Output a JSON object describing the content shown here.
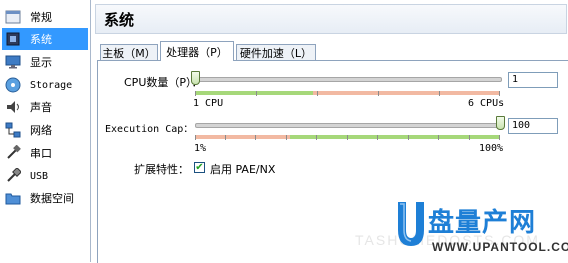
{
  "sidebar": {
    "items": [
      {
        "label": "常规",
        "icon": "general-icon"
      },
      {
        "label": "系统",
        "icon": "system-icon",
        "selected": true
      },
      {
        "label": "显示",
        "icon": "display-icon"
      },
      {
        "label": "Storage",
        "icon": "storage-icon"
      },
      {
        "label": "声音",
        "icon": "audio-icon"
      },
      {
        "label": "网络",
        "icon": "network-icon"
      },
      {
        "label": "串口",
        "icon": "serial-port-icon"
      },
      {
        "label": "USB",
        "icon": "usb-icon"
      },
      {
        "label": "数据空间",
        "icon": "shared-folders-icon"
      }
    ]
  },
  "header": {
    "title": "系统"
  },
  "tabs": [
    {
      "label": "主板（M）"
    },
    {
      "label": "处理器（P）",
      "active": true
    },
    {
      "label": "硬件加速（L）"
    }
  ],
  "cpu": {
    "label": "CPU数量（P）：",
    "value": "1",
    "min_label": "1 CPU",
    "max_label": "6 CPUs",
    "level": 0
  },
  "cap": {
    "label": "Execution Cap：",
    "value": "100",
    "min_label": "1%",
    "max_label": "100%",
    "level": 1
  },
  "features": {
    "label": "扩展特性：",
    "checkbox_label": "启用 PAE/NX",
    "checked": true
  },
  "watermark": {
    "title": "盘量产网",
    "url": "WWW.UPANTOOL.COM",
    "faint": "TASHOMEDOSTS.COM"
  },
  "colors": {
    "selection": "#3399ff",
    "slider_green": "#a6d87a",
    "slider_red": "#f2b9a2",
    "brand_blue": "#1e7fd6"
  }
}
